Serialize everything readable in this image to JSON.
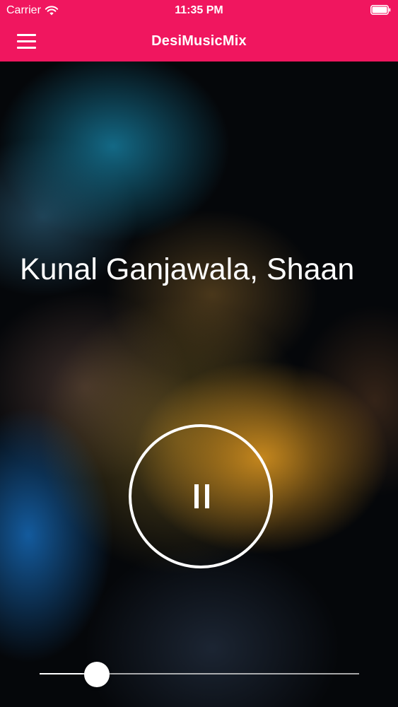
{
  "status_bar": {
    "carrier": "Carrier",
    "time": "11:35 PM"
  },
  "nav": {
    "title": "DesiMusicMix",
    "menu_icon": "hamburger-menu-icon"
  },
  "player": {
    "artist_text": "Kunal Ganjawala, Shaan",
    "button_icon": "pause-icon",
    "progress": 0.18
  },
  "colors": {
    "accent": "#f0165f"
  }
}
